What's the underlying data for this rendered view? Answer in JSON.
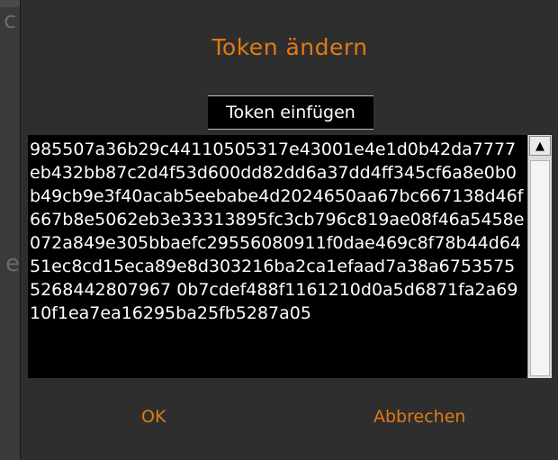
{
  "dialog": {
    "title": "Token ändern",
    "tab_label": "Token einfügen",
    "token_value": "985507a36b29c44110505317e43001e4e1d0b42da7777eb432bb87c2d4f53d600dd82dd6a37dd4ff345cf6a8e0b0b49cb9e3f40acab5eebabe4d2024650aa67bc667138d46f667b8e5062eb3e33313895fc3cb796c819ae08f46a5458e072a849e305bbaefc29556080911f0dae469c8f78b44d6451ec8cd15eca89e8d303216ba2ca1efaad7a38a67535755268442807967 0b7cdef488f1161210d0a5d6871fa2a6910f1ea7ea16295ba25fb5287a05",
    "ok_label": "OK",
    "cancel_label": "Abbrechen"
  },
  "background": {
    "fragment_top": "c",
    "fragment_mid": "e"
  },
  "colors": {
    "accent": "#e07a14",
    "dialog_bg": "#2e2e2e",
    "field_bg": "#000000",
    "text": "#ffffff"
  }
}
